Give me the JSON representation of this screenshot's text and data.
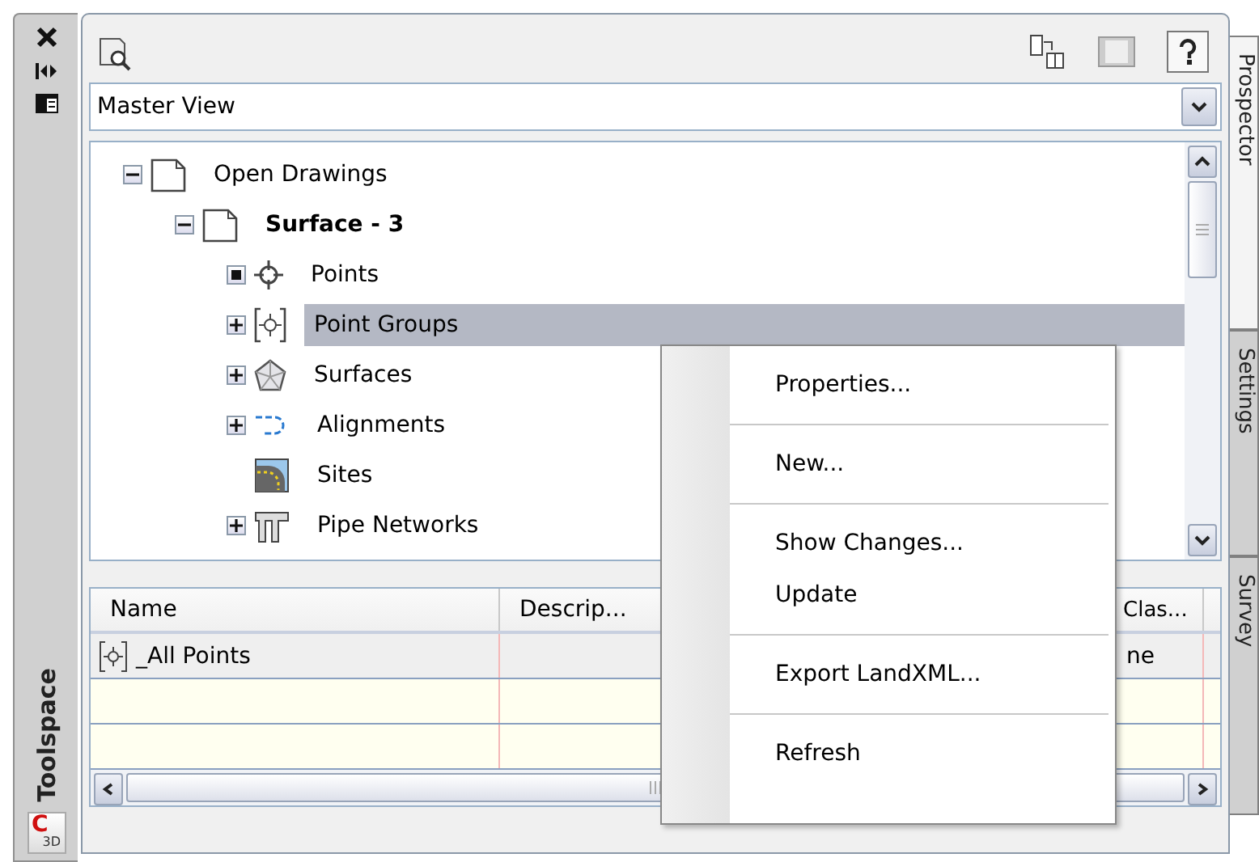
{
  "side_strip": {
    "title": "Toolspace",
    "logo": {
      "letter": "C",
      "sub": "3D"
    }
  },
  "view_selector": {
    "value": "Master View"
  },
  "tree": [
    {
      "label": "Open Drawings",
      "kind": "drawing",
      "expanded": true,
      "current": false,
      "selected": false,
      "children": [
        {
          "label": "Surface - 3",
          "kind": "drawing",
          "expanded": true,
          "current": true,
          "selected": false,
          "children": [
            {
              "label": "Points",
              "kind": "points",
              "current": false,
              "selected": false
            },
            {
              "label": "Point Groups",
              "kind": "group",
              "expanded": false,
              "current": false,
              "selected": true
            },
            {
              "label": "Surfaces",
              "kind": "surface",
              "expanded": false,
              "current": false,
              "selected": false
            },
            {
              "label": "Alignments",
              "kind": "alignment",
              "expanded": false,
              "current": false,
              "selected": false
            },
            {
              "label": "Sites",
              "kind": "site",
              "current": false,
              "selected": false
            },
            {
              "label": "Pipe Networks",
              "kind": "pipe",
              "expanded": false,
              "current": false,
              "selected": false
            }
          ]
        }
      ]
    }
  ],
  "table": {
    "columns": [
      {
        "label": "Name"
      },
      {
        "label": "Descrip..."
      },
      {
        "label": "Clas..."
      }
    ],
    "rows": [
      {
        "name": "_All Points",
        "class": "ne"
      }
    ]
  },
  "context_menu": {
    "groups": [
      [
        "Properties..."
      ],
      [
        "New..."
      ],
      [
        "Show Changes...",
        "Update"
      ],
      [
        "Export LandXML..."
      ],
      [
        "Refresh"
      ]
    ]
  },
  "tabs": [
    {
      "label": "Prospector",
      "selected": true
    },
    {
      "label": "Settings",
      "selected": false
    },
    {
      "label": "Survey",
      "selected": false
    }
  ]
}
